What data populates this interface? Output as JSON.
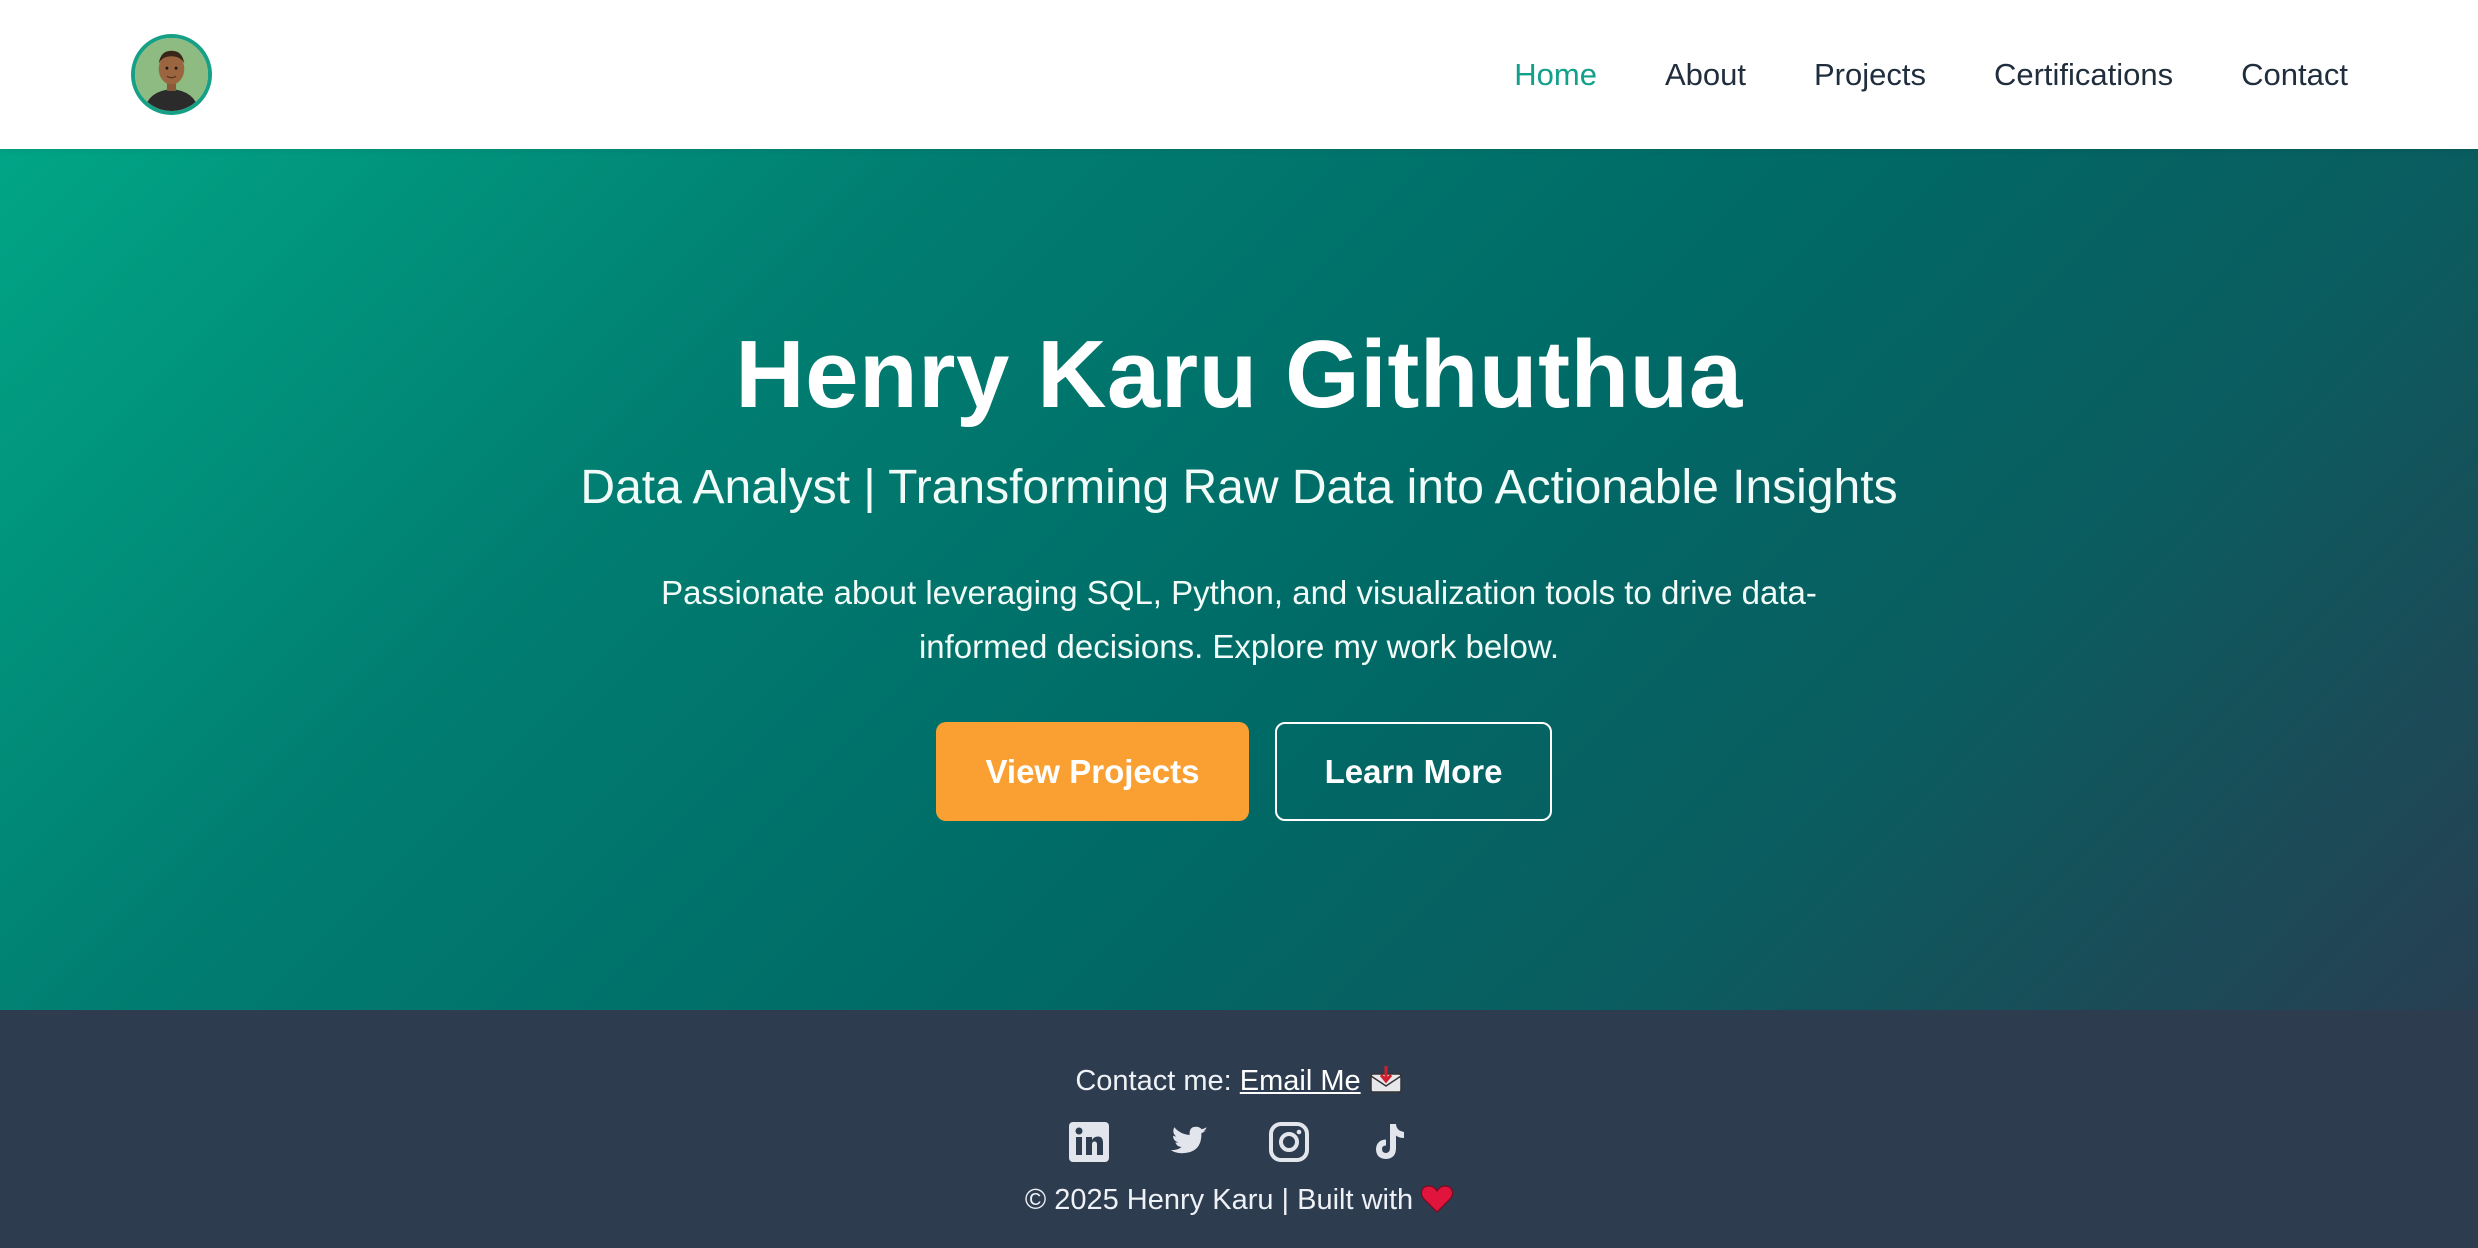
{
  "header": {
    "avatar_alt": "Henry Karu avatar",
    "nav": [
      {
        "label": "Home",
        "active": true
      },
      {
        "label": "About",
        "active": false
      },
      {
        "label": "Projects",
        "active": false
      },
      {
        "label": "Certifications",
        "active": false
      },
      {
        "label": "Contact",
        "active": false
      }
    ]
  },
  "hero": {
    "title": "Henry Karu Githuthua",
    "subtitle": "Data Analyst | Transforming Raw Data into Actionable Insights",
    "description": "Passionate about leveraging SQL, Python, and visualization tools to drive data-informed decisions. Explore my work below.",
    "primary_button": "View Projects",
    "secondary_button": "Learn More"
  },
  "footer": {
    "contact_prefix": "Contact me: ",
    "email_link": "Email Me",
    "social_icons": [
      "linkedin-icon",
      "twitter-icon",
      "instagram-icon",
      "tiktok-icon"
    ],
    "copyright": "© 2025 Henry Karu | Built with"
  },
  "colors": {
    "accent": "#11a08a",
    "button_primary": "#fa9f32",
    "hero_gradient_start": "#01a586",
    "hero_gradient_end": "#273f52",
    "footer_bg": "#2e3c50",
    "nav_text": "#1f2d3d"
  }
}
